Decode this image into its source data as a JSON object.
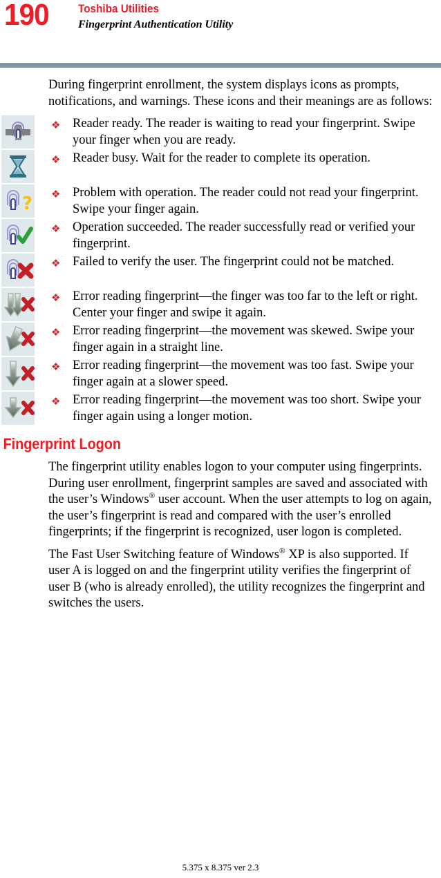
{
  "header": {
    "page_number": "190",
    "chapter_title": "Toshiba Utilities",
    "section_title": "Fingerprint Authentication Utility",
    "rule_color": "#7e95ae",
    "accent_color": "#ee1c25"
  },
  "intro": {
    "paragraph": "During fingerprint enrollment, the system displays icons as prompts, notifications, and warnings. These icons and their meanings are as follows:"
  },
  "bullets": [
    {
      "icon": "fingerprint-reader-ready-icon",
      "text": "Reader ready. The reader is waiting to read your fingerprint. Swipe your finger when you are ready."
    },
    {
      "icon": "hourglass-busy-icon",
      "text": "Reader busy. Wait for the reader to complete its operation."
    },
    {
      "icon": "fingerprint-question-icon",
      "text": "Problem with operation. The reader could not read your fingerprint. Swipe your finger again."
    },
    {
      "icon": "fingerprint-check-icon",
      "text": "Operation succeeded. The reader successfully read or verified your fingerprint."
    },
    {
      "icon": "fingerprint-x-icon",
      "text": "Failed to verify the user. The fingerprint could not be matched."
    },
    {
      "icon": "double-arrow-offcenter-error-icon",
      "text": "Error reading fingerprint—the finger was too far to the left or right. Center your finger and swipe it again."
    },
    {
      "icon": "skewed-arrow-error-icon",
      "text": "Error reading fingerprint—the movement was skewed. Swipe your finger again in a straight line."
    },
    {
      "icon": "long-arrow-fast-error-icon",
      "text": "Error reading fingerprint—the movement was too fast. Swipe your finger again at a slower speed."
    },
    {
      "icon": "short-arrow-error-icon",
      "text": "Error reading fingerprint—the movement was too short. Swipe your finger again using a longer motion."
    }
  ],
  "logon_section": {
    "heading": "Fingerprint Logon",
    "paragraph_1_part_1": "The fingerprint utility enables logon to your computer using fingerprints. During user enrollment, fingerprint samples are saved and associated with the user’s Windows",
    "paragraph_1_reg": "®",
    "paragraph_1_part_2": " user account. When the user attempts to log on again, the user’s fingerprint is read and compared with the user’s enrolled fingerprints; if the fingerprint is recognized, user logon is completed.",
    "paragraph_2_part_1": "The Fast User Switching feature of Windows",
    "paragraph_2_reg": "®",
    "paragraph_2_part_2": " XP is also supported. If user A is logged on and the fingerprint utility verifies the fingerprint of user B (who is already enrolled), the utility recognizes the fingerprint and switches the users."
  },
  "footer": {
    "text": "5.375 x 8.375 ver 2.3"
  },
  "bullet_glyph": "❖"
}
